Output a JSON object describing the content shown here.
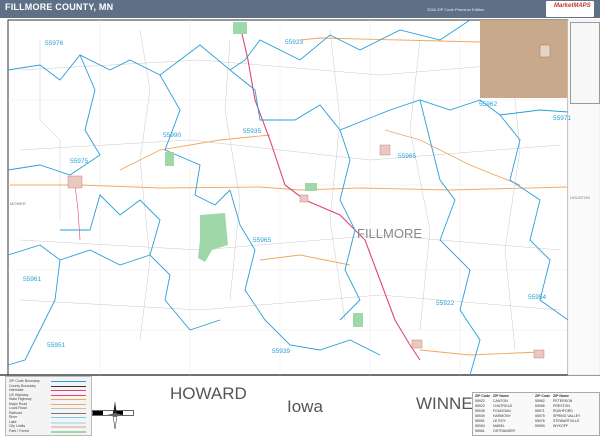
{
  "header": {
    "title": "FILLMORE COUNTY, MN",
    "edition": "2026 ZIP Code Premium Edition",
    "logo_text": "MarketMAPS"
  },
  "map": {
    "county_label": "FILLMORE",
    "state_label": "Iowa",
    "neighbor_counties_south": [
      "HOWARD",
      "WINNESHIEK"
    ],
    "neighbor_counties_side": {
      "west": "MOWER",
      "east": "HOUSTON"
    },
    "zip_labels": [
      "55976",
      "55923",
      "55962",
      "55971",
      "55990",
      "55935",
      "55965",
      "55975",
      "55965",
      "55922",
      "55954",
      "55961",
      "55951",
      "55939"
    ],
    "colors": {
      "zip_boundary": "#2a9fd6",
      "highway": "#e0447a",
      "road": "#f0a860",
      "city_fill": "#c9a98c",
      "park_fill": "#9fd8a8",
      "border": "#333333"
    }
  },
  "legend": {
    "rows": [
      "ZIP Code Boundary",
      "County Boundary",
      "Interstate",
      "US Highway",
      "State Highway",
      "Major Road",
      "Local Road",
      "Railroad",
      "River",
      "Lake",
      "City Limits",
      "Park / Forest"
    ]
  },
  "zip_table": {
    "headers": [
      "ZIP Code",
      "ZIP Name",
      "ZIP Code",
      "ZIP Name"
    ],
    "rows": [
      [
        "55922",
        "CANTON",
        "55962",
        "PETERSON"
      ],
      [
        "55923",
        "CHATFIELD",
        "55965",
        "PRESTON"
      ],
      [
        "55935",
        "FOUNTAIN",
        "55971",
        "RUSHFORD"
      ],
      [
        "55939",
        "HARMONY",
        "55975",
        "SPRING VALLEY"
      ],
      [
        "55951",
        "LE ROY",
        "55976",
        "STEWARTVILLE"
      ],
      [
        "55954",
        "MABEL",
        "55990",
        "WYKOFF"
      ],
      [
        "55961",
        "OSTRANDER",
        "",
        ""
      ]
    ]
  }
}
